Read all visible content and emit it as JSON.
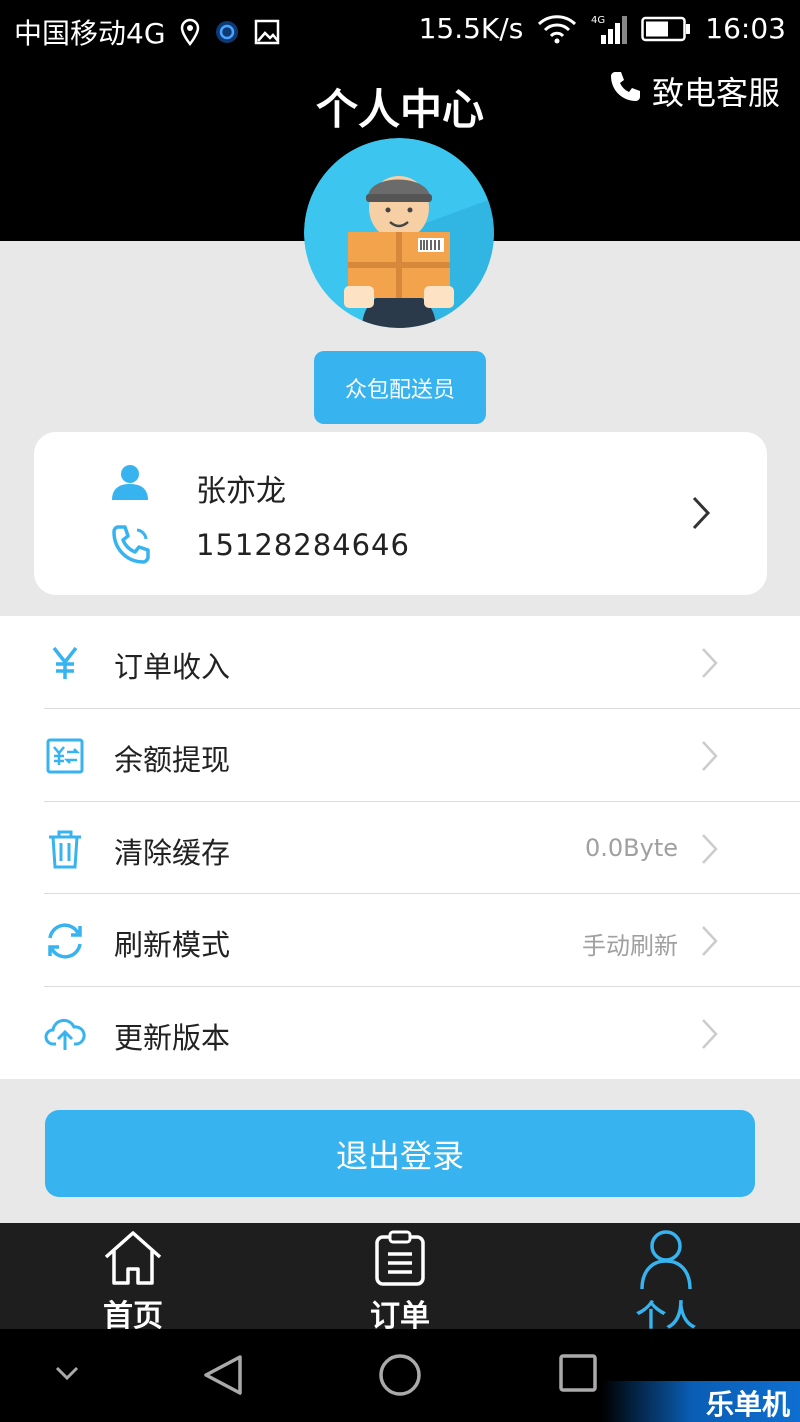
{
  "status_bar": {
    "carrier": "中国移动4G",
    "network_speed": "15.5K/s",
    "time": "16:03"
  },
  "header": {
    "title": "个人中心",
    "call_service_label": "致电客服"
  },
  "profile": {
    "role_badge": "众包配送员",
    "name": "张亦龙",
    "phone": "15128284646"
  },
  "menu": {
    "items": [
      {
        "label": "订单收入",
        "value": "",
        "icon": "yen-icon"
      },
      {
        "label": "余额提现",
        "value": "",
        "icon": "withdraw-icon"
      },
      {
        "label": "清除缓存",
        "value": "0.0Byte",
        "icon": "trash-icon"
      },
      {
        "label": "刷新模式",
        "value": "手动刷新",
        "icon": "refresh-icon"
      },
      {
        "label": "更新版本",
        "value": "",
        "icon": "cloud-upload-icon"
      }
    ]
  },
  "logout_label": "退出登录",
  "tabbar": {
    "tabs": [
      {
        "label": "首页",
        "icon": "home-icon",
        "active": false
      },
      {
        "label": "订单",
        "icon": "clipboard-icon",
        "active": false
      },
      {
        "label": "个人",
        "icon": "person-icon",
        "active": true
      }
    ]
  },
  "watermark": "乐单机",
  "colors": {
    "accent": "#37b3ef",
    "header_bg": "#000000",
    "page_bg": "#e8e8e8",
    "tabbar_bg": "#1e1e1e"
  }
}
